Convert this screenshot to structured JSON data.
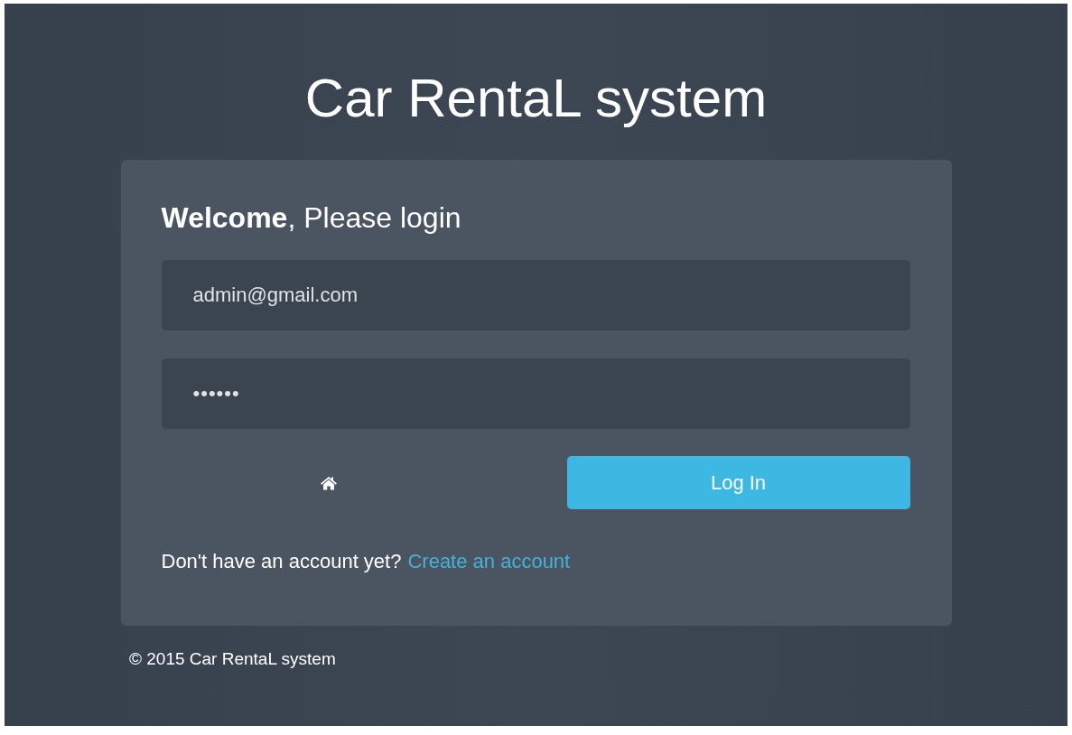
{
  "title": "Car RentaL system",
  "login": {
    "heading": "**Welcome**, Please login",
    "email": {
      "value": "admin@gmail.com"
    },
    "password": {
      "value": "••••••"
    },
    "submit": "Log In",
    "prompt": "Don't have an account yet?",
    "link": "Create an account"
  },
  "footer": "© 2015 Car RentaL system"
}
